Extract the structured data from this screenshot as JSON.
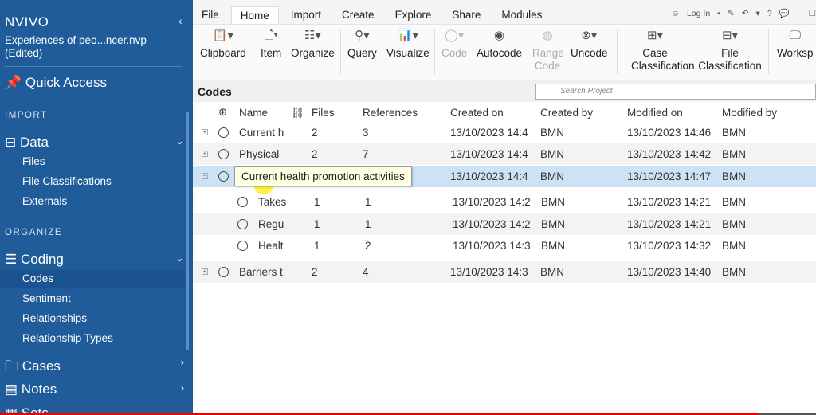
{
  "sidebar": {
    "logo": "NVIVO",
    "project": "Experiences of peo...ncer.nvp",
    "edited": "(Edited)",
    "quick_access": "Quick Access",
    "import_label": "IMPORT",
    "data": "Data",
    "data_items": [
      "Files",
      "File Classifications",
      "Externals"
    ],
    "organize_label": "ORGANIZE",
    "coding": "Coding",
    "coding_items": [
      "Codes",
      "Sentiment",
      "Relationships",
      "Relationship Types"
    ],
    "cases": "Cases",
    "notes": "Notes",
    "sets": "Sets"
  },
  "ribbon": {
    "tabs": [
      "File",
      "Home",
      "Import",
      "Create",
      "Explore",
      "Share",
      "Modules"
    ],
    "active_tab": "Home",
    "qat": {
      "login": "Log In",
      "help": "?"
    },
    "tools": [
      "Clipboard",
      "Item",
      "Organize",
      "Query",
      "Visualize",
      "Code",
      "Autocode",
      "Range Code",
      "Uncode",
      "Case Classification",
      "File Classification",
      "Worksp"
    ]
  },
  "codes": {
    "title": "Codes",
    "search_placeholder": "Search Project",
    "columns": [
      "Name",
      "Files",
      "References",
      "Created on",
      "Created by",
      "Modified on",
      "Modified by"
    ],
    "rows": [
      {
        "name": "Current h",
        "files": "2",
        "refs": "3",
        "created": "13/10/2023 14:4",
        "by": "BMN",
        "modified": "13/10/2023 14:46",
        "mby": "BMN"
      },
      {
        "name": "Physical",
        "files": "2",
        "refs": "7",
        "created": "13/10/2023 14:4",
        "by": "BMN",
        "modified": "13/10/2023 14:42",
        "mby": "BMN"
      },
      {
        "name": "",
        "files": "",
        "refs": "",
        "created": "13/10/2023 14:4",
        "by": "BMN",
        "modified": "13/10/2023 14:47",
        "mby": "BMN"
      },
      {
        "name": "Takes",
        "files": "1",
        "refs": "1",
        "created": "13/10/2023 14:2",
        "by": "BMN",
        "modified": "13/10/2023 14:21",
        "mby": "BMN"
      },
      {
        "name": "Regu",
        "files": "1",
        "refs": "1",
        "created": "13/10/2023 14:2",
        "by": "BMN",
        "modified": "13/10/2023 14:21",
        "mby": "BMN"
      },
      {
        "name": "Healt",
        "files": "1",
        "refs": "2",
        "created": "13/10/2023 14:3",
        "by": "BMN",
        "modified": "13/10/2023 14:32",
        "mby": "BMN"
      },
      {
        "name": "Barriers t",
        "files": "2",
        "refs": "4",
        "created": "13/10/2023 14:3",
        "by": "BMN",
        "modified": "13/10/2023 14:40",
        "mby": "BMN"
      }
    ],
    "tooltip": "Current health promotion activities"
  },
  "colors": {
    "sidebar": "#1f5c99",
    "selected_row": "#cde2f5",
    "progress": "#e00000"
  },
  "video_progress": 0.93
}
